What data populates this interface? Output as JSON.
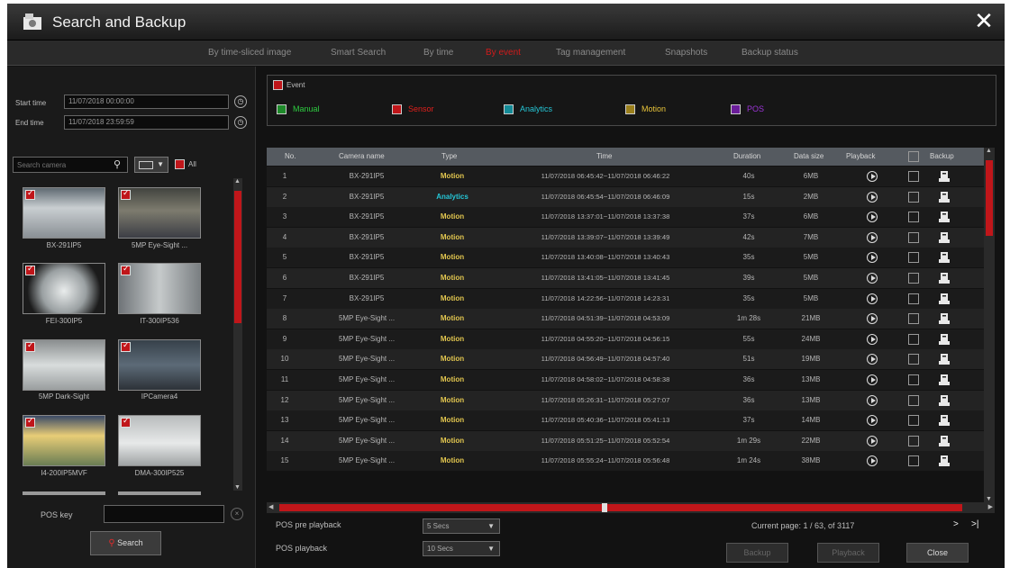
{
  "window": {
    "title": "Search and Backup",
    "close_icon": "✕"
  },
  "tabs": [
    {
      "label": "By time-sliced image"
    },
    {
      "label": "Smart Search"
    },
    {
      "label": "By time"
    },
    {
      "label": "By event",
      "active": true
    },
    {
      "label": "Tag management"
    },
    {
      "label": "Snapshots"
    },
    {
      "label": "Backup status"
    }
  ],
  "filters": {
    "start_label": "Start time",
    "start_value": "11/07/2018 00:00:00",
    "end_label": "End time",
    "end_value": "11/07/2018 23:59:59",
    "search_placeholder": "Search camera",
    "view_value": "",
    "all_label": "All"
  },
  "cameras": [
    {
      "name": "BX-291IP5",
      "checked": true
    },
    {
      "name": "5MP Eye-Sight ...",
      "checked": true
    },
    {
      "name": "FEI-300IP5",
      "checked": true
    },
    {
      "name": "IT-300IP536",
      "checked": true
    },
    {
      "name": "5MP Dark-Sight",
      "checked": true
    },
    {
      "name": "IPCamera4",
      "checked": true
    },
    {
      "name": "I4-200IP5MVF",
      "checked": true
    },
    {
      "name": "DMA-300IP525",
      "checked": true
    }
  ],
  "pos_key_label": "POS key",
  "search_button": "Search",
  "event": {
    "header_label": "Event",
    "types": [
      {
        "label": "Manual",
        "color": "#2ecc40"
      },
      {
        "label": "Sensor",
        "color": "#e0201c"
      },
      {
        "label": "Analytics",
        "color": "#25c6d6"
      },
      {
        "label": "Motion",
        "color": "#e8c43a"
      },
      {
        "label": "POS",
        "color": "#9b34d6"
      }
    ]
  },
  "table": {
    "headers": {
      "no": "No.",
      "camera": "Camera name",
      "type": "Type",
      "time": "Time",
      "duration": "Duration",
      "size": "Data size",
      "playback": "Playback",
      "backup": "Backup"
    },
    "rows": [
      {
        "no": "1",
        "camera": "BX-291IP5",
        "type": "Motion",
        "time": "11/07/2018 06:45:42~11/07/2018 06:46:22",
        "duration": "40s",
        "size": "6MB"
      },
      {
        "no": "2",
        "camera": "BX-291IP5",
        "type": "Analytics",
        "time": "11/07/2018 06:45:54~11/07/2018 06:46:09",
        "duration": "15s",
        "size": "2MB"
      },
      {
        "no": "3",
        "camera": "BX-291IP5",
        "type": "Motion",
        "time": "11/07/2018 13:37:01~11/07/2018 13:37:38",
        "duration": "37s",
        "size": "6MB"
      },
      {
        "no": "4",
        "camera": "BX-291IP5",
        "type": "Motion",
        "time": "11/07/2018 13:39:07~11/07/2018 13:39:49",
        "duration": "42s",
        "size": "7MB"
      },
      {
        "no": "5",
        "camera": "BX-291IP5",
        "type": "Motion",
        "time": "11/07/2018 13:40:08~11/07/2018 13:40:43",
        "duration": "35s",
        "size": "5MB"
      },
      {
        "no": "6",
        "camera": "BX-291IP5",
        "type": "Motion",
        "time": "11/07/2018 13:41:05~11/07/2018 13:41:45",
        "duration": "39s",
        "size": "5MB"
      },
      {
        "no": "7",
        "camera": "BX-291IP5",
        "type": "Motion",
        "time": "11/07/2018 14:22:56~11/07/2018 14:23:31",
        "duration": "35s",
        "size": "5MB"
      },
      {
        "no": "8",
        "camera": "5MP Eye-Sight ...",
        "type": "Motion",
        "time": "11/07/2018 04:51:39~11/07/2018 04:53:09",
        "duration": "1m 28s",
        "size": "21MB"
      },
      {
        "no": "9",
        "camera": "5MP Eye-Sight ...",
        "type": "Motion",
        "time": "11/07/2018 04:55:20~11/07/2018 04:56:15",
        "duration": "55s",
        "size": "24MB"
      },
      {
        "no": "10",
        "camera": "5MP Eye-Sight ...",
        "type": "Motion",
        "time": "11/07/2018 04:56:49~11/07/2018 04:57:40",
        "duration": "51s",
        "size": "19MB"
      },
      {
        "no": "11",
        "camera": "5MP Eye-Sight ...",
        "type": "Motion",
        "time": "11/07/2018 04:58:02~11/07/2018 04:58:38",
        "duration": "36s",
        "size": "13MB"
      },
      {
        "no": "12",
        "camera": "5MP Eye-Sight ...",
        "type": "Motion",
        "time": "11/07/2018 05:26:31~11/07/2018 05:27:07",
        "duration": "36s",
        "size": "13MB"
      },
      {
        "no": "13",
        "camera": "5MP Eye-Sight ...",
        "type": "Motion",
        "time": "11/07/2018 05:40:36~11/07/2018 05:41:13",
        "duration": "37s",
        "size": "14MB"
      },
      {
        "no": "14",
        "camera": "5MP Eye-Sight ...",
        "type": "Motion",
        "time": "11/07/2018 05:51:25~11/07/2018 05:52:54",
        "duration": "1m 29s",
        "size": "22MB"
      },
      {
        "no": "15",
        "camera": "5MP Eye-Sight ...",
        "type": "Motion",
        "time": "11/07/2018 05:55:24~11/07/2018 05:56:48",
        "duration": "1m 24s",
        "size": "38MB"
      }
    ]
  },
  "pos_pre_playback": {
    "label": "POS pre playback",
    "value": "5 Secs"
  },
  "pos_playback": {
    "label": "POS playback",
    "value": "10 Secs"
  },
  "pagination": {
    "text": "Current page: 1 / 63, of 3117",
    "next": ">",
    "last": ">|"
  },
  "buttons": {
    "backup": "Backup",
    "playback": "Playback",
    "close": "Close"
  },
  "colors": {
    "accent": "#c0161a",
    "motion": "#e2c64f",
    "analytics": "#25c6d6"
  }
}
